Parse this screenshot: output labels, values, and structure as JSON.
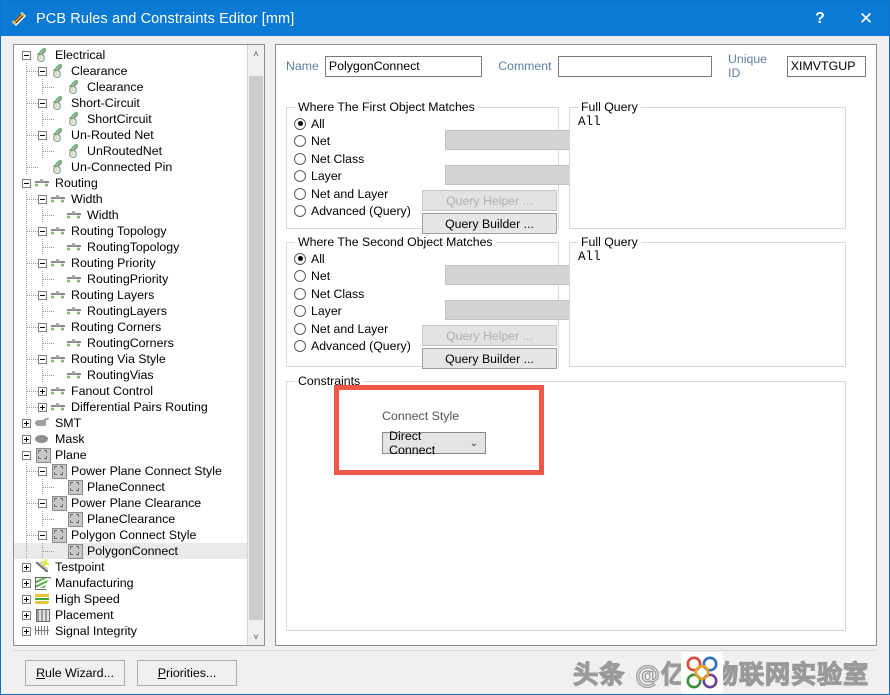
{
  "window": {
    "title": "PCB Rules and Constraints Editor [mm]",
    "icon": "altium-pcb-icon",
    "help_label": "?",
    "close_label": "✕"
  },
  "tree": {
    "scroll_up_label": "˄",
    "scroll_down_label": "˅",
    "nodes": [
      {
        "label": "Electrical",
        "depth": 0,
        "state": "expanded",
        "icon": "electrical-icon",
        "selected": false
      },
      {
        "label": "Clearance",
        "depth": 1,
        "state": "expanded",
        "icon": "electrical-icon",
        "selected": false
      },
      {
        "label": "Clearance",
        "depth": 2,
        "state": "leaf",
        "icon": "electrical-icon",
        "selected": false
      },
      {
        "label": "Short-Circuit",
        "depth": 1,
        "state": "expanded",
        "icon": "electrical-icon",
        "selected": false
      },
      {
        "label": "ShortCircuit",
        "depth": 2,
        "state": "leaf",
        "icon": "electrical-icon",
        "selected": false
      },
      {
        "label": "Un-Routed Net",
        "depth": 1,
        "state": "expanded",
        "icon": "electrical-icon",
        "selected": false
      },
      {
        "label": "UnRoutedNet",
        "depth": 2,
        "state": "leaf",
        "icon": "electrical-icon",
        "selected": false
      },
      {
        "label": "Un-Connected Pin",
        "depth": 1,
        "state": "leaf",
        "icon": "electrical-icon",
        "selected": false
      },
      {
        "label": "Routing",
        "depth": 0,
        "state": "expanded",
        "icon": "routing-icon",
        "selected": false
      },
      {
        "label": "Width",
        "depth": 1,
        "state": "expanded",
        "icon": "routing-icon",
        "selected": false
      },
      {
        "label": "Width",
        "depth": 2,
        "state": "leaf",
        "icon": "routing-icon",
        "selected": false
      },
      {
        "label": "Routing Topology",
        "depth": 1,
        "state": "expanded",
        "icon": "routing-icon",
        "selected": false
      },
      {
        "label": "RoutingTopology",
        "depth": 2,
        "state": "leaf",
        "icon": "routing-icon",
        "selected": false
      },
      {
        "label": "Routing Priority",
        "depth": 1,
        "state": "expanded",
        "icon": "routing-icon",
        "selected": false
      },
      {
        "label": "RoutingPriority",
        "depth": 2,
        "state": "leaf",
        "icon": "routing-icon",
        "selected": false
      },
      {
        "label": "Routing Layers",
        "depth": 1,
        "state": "expanded",
        "icon": "routing-icon",
        "selected": false
      },
      {
        "label": "RoutingLayers",
        "depth": 2,
        "state": "leaf",
        "icon": "routing-icon",
        "selected": false
      },
      {
        "label": "Routing Corners",
        "depth": 1,
        "state": "expanded",
        "icon": "routing-icon",
        "selected": false
      },
      {
        "label": "RoutingCorners",
        "depth": 2,
        "state": "leaf",
        "icon": "routing-icon",
        "selected": false
      },
      {
        "label": "Routing Via Style",
        "depth": 1,
        "state": "expanded",
        "icon": "routing-icon",
        "selected": false
      },
      {
        "label": "RoutingVias",
        "depth": 2,
        "state": "leaf",
        "icon": "routing-icon",
        "selected": false
      },
      {
        "label": "Fanout Control",
        "depth": 1,
        "state": "collapsed",
        "icon": "routing-icon",
        "selected": false
      },
      {
        "label": "Differential Pairs Routing",
        "depth": 1,
        "state": "collapsed",
        "icon": "routing-icon",
        "selected": false
      },
      {
        "label": "SMT",
        "depth": 0,
        "state": "collapsed",
        "icon": "smt-icon",
        "selected": false
      },
      {
        "label": "Mask",
        "depth": 0,
        "state": "collapsed",
        "icon": "mask-icon",
        "selected": false
      },
      {
        "label": "Plane",
        "depth": 0,
        "state": "expanded",
        "icon": "plane-icon",
        "selected": false
      },
      {
        "label": "Power Plane Connect Style",
        "depth": 1,
        "state": "expanded",
        "icon": "plane-icon",
        "selected": false
      },
      {
        "label": "PlaneConnect",
        "depth": 2,
        "state": "leaf",
        "icon": "plane-icon",
        "selected": false
      },
      {
        "label": "Power Plane Clearance",
        "depth": 1,
        "state": "expanded",
        "icon": "plane-icon",
        "selected": false
      },
      {
        "label": "PlaneClearance",
        "depth": 2,
        "state": "leaf",
        "icon": "plane-icon",
        "selected": false
      },
      {
        "label": "Polygon Connect Style",
        "depth": 1,
        "state": "expanded",
        "icon": "plane-icon",
        "selected": false
      },
      {
        "label": "PolygonConnect",
        "depth": 2,
        "state": "leaf",
        "icon": "plane-icon",
        "selected": true
      },
      {
        "label": "Testpoint",
        "depth": 0,
        "state": "collapsed",
        "icon": "testpoint-icon",
        "selected": false
      },
      {
        "label": "Manufacturing",
        "depth": 0,
        "state": "collapsed",
        "icon": "manufacturing-icon",
        "selected": false
      },
      {
        "label": "High Speed",
        "depth": 0,
        "state": "collapsed",
        "icon": "high-speed-icon",
        "selected": false
      },
      {
        "label": "Placement",
        "depth": 0,
        "state": "collapsed",
        "icon": "placement-icon",
        "selected": false
      },
      {
        "label": "Signal Integrity",
        "depth": 0,
        "state": "collapsed",
        "icon": "signal-integrity-icon",
        "selected": false
      }
    ]
  },
  "form": {
    "name_label": "Name",
    "name_value": "PolygonConnect",
    "comment_label": "Comment",
    "comment_value": "",
    "unique_id_label": "Unique ID",
    "unique_id_value": "XIMVTGUP"
  },
  "first_object": {
    "title": "Where The First Object Matches",
    "options": [
      {
        "label": "All",
        "selected": true
      },
      {
        "label": "Net",
        "selected": false
      },
      {
        "label": "Net Class",
        "selected": false
      },
      {
        "label": "Layer",
        "selected": false
      },
      {
        "label": "Net and Layer",
        "selected": false
      },
      {
        "label": "Advanced (Query)",
        "selected": false
      }
    ],
    "net_combo_value": "",
    "netclass_combo_value": "",
    "query_helper_label": "Query Helper ...",
    "query_builder_label": "Query Builder ...",
    "full_query_title": "Full Query",
    "full_query_text": "All"
  },
  "second_object": {
    "title": "Where The Second Object Matches",
    "options": [
      {
        "label": "All",
        "selected": true
      },
      {
        "label": "Net",
        "selected": false
      },
      {
        "label": "Net Class",
        "selected": false
      },
      {
        "label": "Layer",
        "selected": false
      },
      {
        "label": "Net and Layer",
        "selected": false
      },
      {
        "label": "Advanced (Query)",
        "selected": false
      }
    ],
    "net_combo_value": "",
    "netclass_combo_value": "",
    "query_helper_label": "Query Helper ...",
    "query_builder_label": "Query Builder ...",
    "full_query_title": "Full Query",
    "full_query_text": "All"
  },
  "constraints": {
    "title": "Constraints",
    "connect_style_label": "Connect Style",
    "connect_style_value": "Direct Connect",
    "dropdown_arrow": "⌄",
    "highlight_color": "#f2584a"
  },
  "footer": {
    "rule_wizard_label": "Rule Wizard...",
    "rule_wizard_accel": "R",
    "priorities_label": "Priorities...",
    "priorities_accel": "P",
    "watermark_text_before": "头条 @亿佰",
    "watermark_text_after": "物联网实验室"
  }
}
